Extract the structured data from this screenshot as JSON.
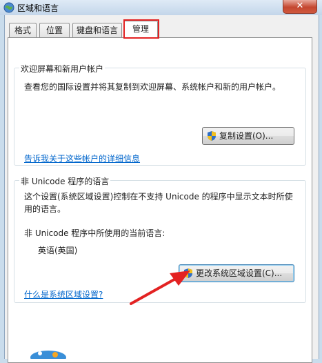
{
  "window": {
    "title": "区域和语言",
    "close_symbol": "✕"
  },
  "tabs": [
    {
      "label": "格式",
      "active": false
    },
    {
      "label": "位置",
      "active": false
    },
    {
      "label": "键盘和语言",
      "active": false
    },
    {
      "label": "管理",
      "active": true
    }
  ],
  "welcome_group": {
    "title": "欢迎屏幕和新用户帐户",
    "description": "查看您的国际设置并将其复制到欢迎屏幕、系统帐户和新的用户帐户。",
    "copy_button": "复制设置(O)...",
    "link": "告诉我关于这些帐户的详细信息"
  },
  "unicode_group": {
    "title": "非 Unicode 程序的语言",
    "description_line1": "这个设置(系统区域设置)控制在不支持 Unicode 的程序中显示文本时所使",
    "description_line2": "用的语言。",
    "current_label": "非 Unicode 程序中所使用的当前语言:",
    "current_value": "英语(英国)",
    "change_button": "更改系统区域设置(C)...",
    "link": "什么是系统区域设置?"
  },
  "colors": {
    "highlight_red": "#e32222",
    "link_blue": "#0066cc"
  }
}
